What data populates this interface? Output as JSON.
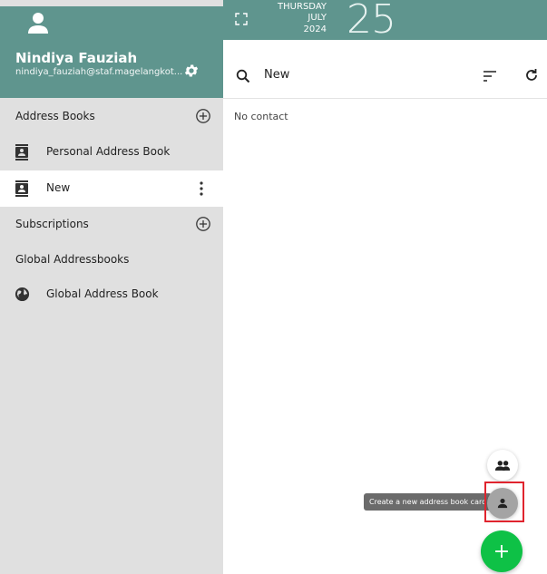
{
  "user": {
    "name": "Nindiya Fauziah",
    "email": "nindiya_fauziah@staf.magelangkot..."
  },
  "date": {
    "weekday": "THURSDAY",
    "month": "JULY",
    "year": "2024",
    "day": "25"
  },
  "sidebar": {
    "address_books_label": "Address Books",
    "items": [
      {
        "label": "Personal Address Book"
      },
      {
        "label": "New"
      }
    ],
    "subscriptions_label": "Subscriptions",
    "global_label": "Global Addressbooks",
    "global_items": [
      {
        "label": "Global Address Book"
      }
    ]
  },
  "main": {
    "title": "New",
    "empty_text": "No contact"
  },
  "fab": {
    "tooltip": "Create a new address book card",
    "main_label": "+"
  },
  "colors": {
    "header": "#5f958e",
    "sidebar": "#e0e0e0",
    "fab": "#0ec146",
    "highlight": "#e0242e"
  }
}
